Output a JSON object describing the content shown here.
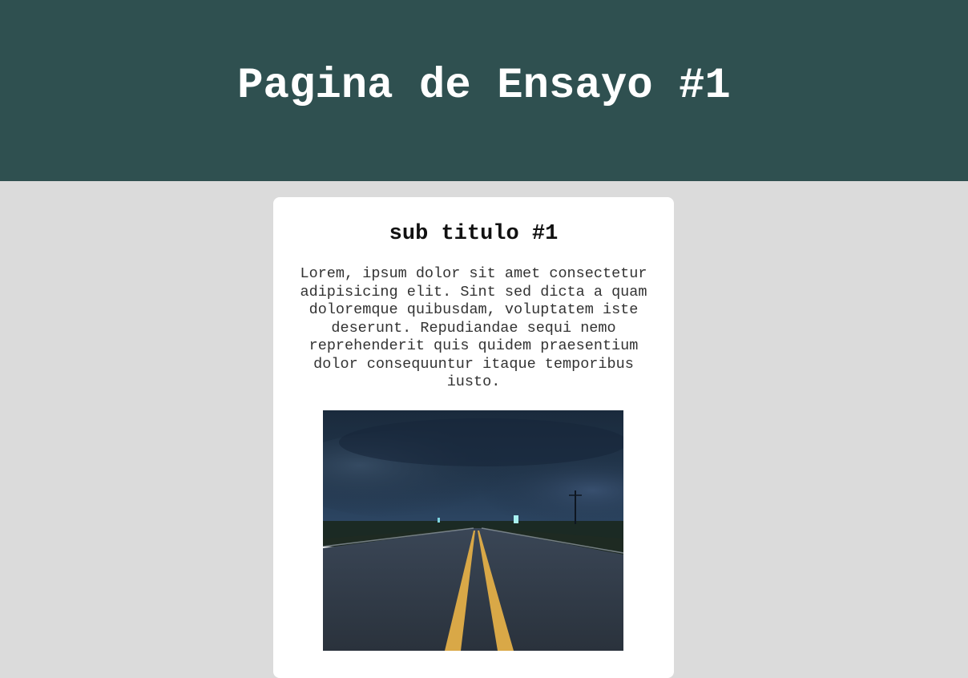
{
  "header": {
    "title": "Pagina de Ensayo #1"
  },
  "card": {
    "subtitle": "sub titulo #1",
    "body": "Lorem, ipsum dolor sit amet consectetur adipisicing elit. Sint sed dicta a quam doloremque quibusdam, voluptatem iste deserunt. Repudiandae sequi nemo reprehenderit quis quidem praesentium dolor consequuntur itaque temporibus iusto."
  },
  "colors": {
    "header_bg": "#2f5050",
    "page_bg": "#dbdbdb",
    "card_bg": "#ffffff"
  }
}
